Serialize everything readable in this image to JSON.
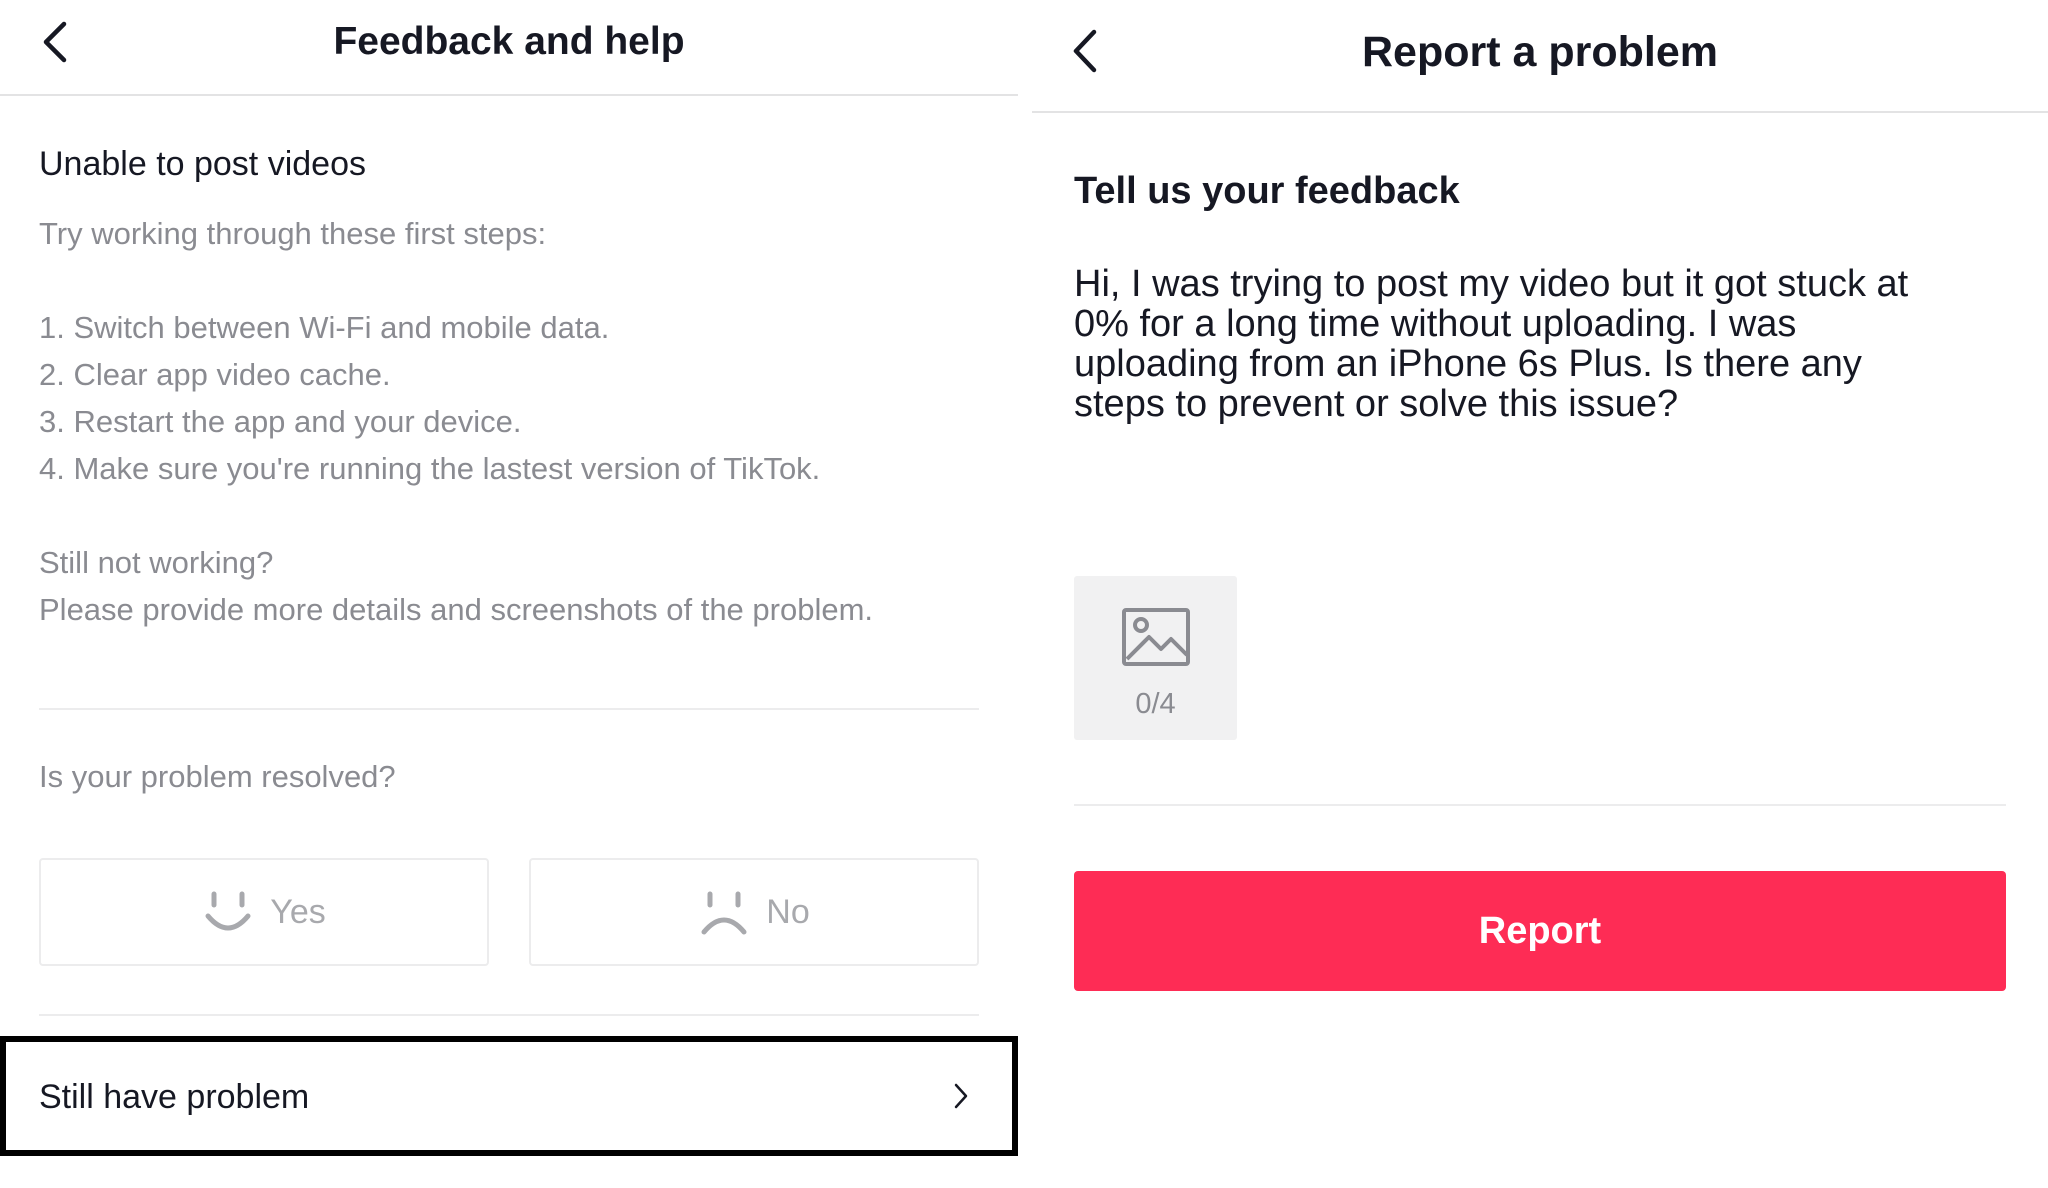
{
  "left_panel": {
    "header": {
      "title": "Feedback and help",
      "back_icon": "chevron-left-icon"
    },
    "content": {
      "title": "Unable to post videos",
      "intro": "Try working through these first steps:",
      "steps": [
        "1. Switch between Wi-Fi and mobile data.",
        "2. Clear app video cache.",
        "3. Restart the app and your device.",
        "4. Make sure you're running the lastest version of TikTok."
      ],
      "still_not_working": "Still not working?",
      "provide_details": "Please provide more details and screenshots of the problem."
    },
    "resolved": {
      "question": "Is your problem resolved?",
      "yes_label": "Yes",
      "yes_icon": "smiley-face-icon",
      "no_label": "No",
      "no_icon": "sad-face-icon"
    },
    "still_have_problem": {
      "label": "Still have problem",
      "icon": "chevron-right-icon"
    }
  },
  "right_panel": {
    "header": {
      "title": "Report a problem",
      "back_icon": "chevron-left-icon"
    },
    "feedback_title": "Tell us your feedback",
    "feedback_text": "Hi, I was trying to post my video but it got stuck at\n0% for a long time without uploading. I was\nuploading from an iPhone 6s Plus. Is there any\nsteps to prevent or solve this issue?",
    "upload": {
      "icon": "image-icon",
      "count": "0/4"
    },
    "report_button": "Report"
  },
  "colors": {
    "accent": "#fe2c55",
    "text_primary": "#161823",
    "text_secondary": "#8a8b91",
    "divider": "#ececed",
    "highlight_border": "#000000"
  }
}
